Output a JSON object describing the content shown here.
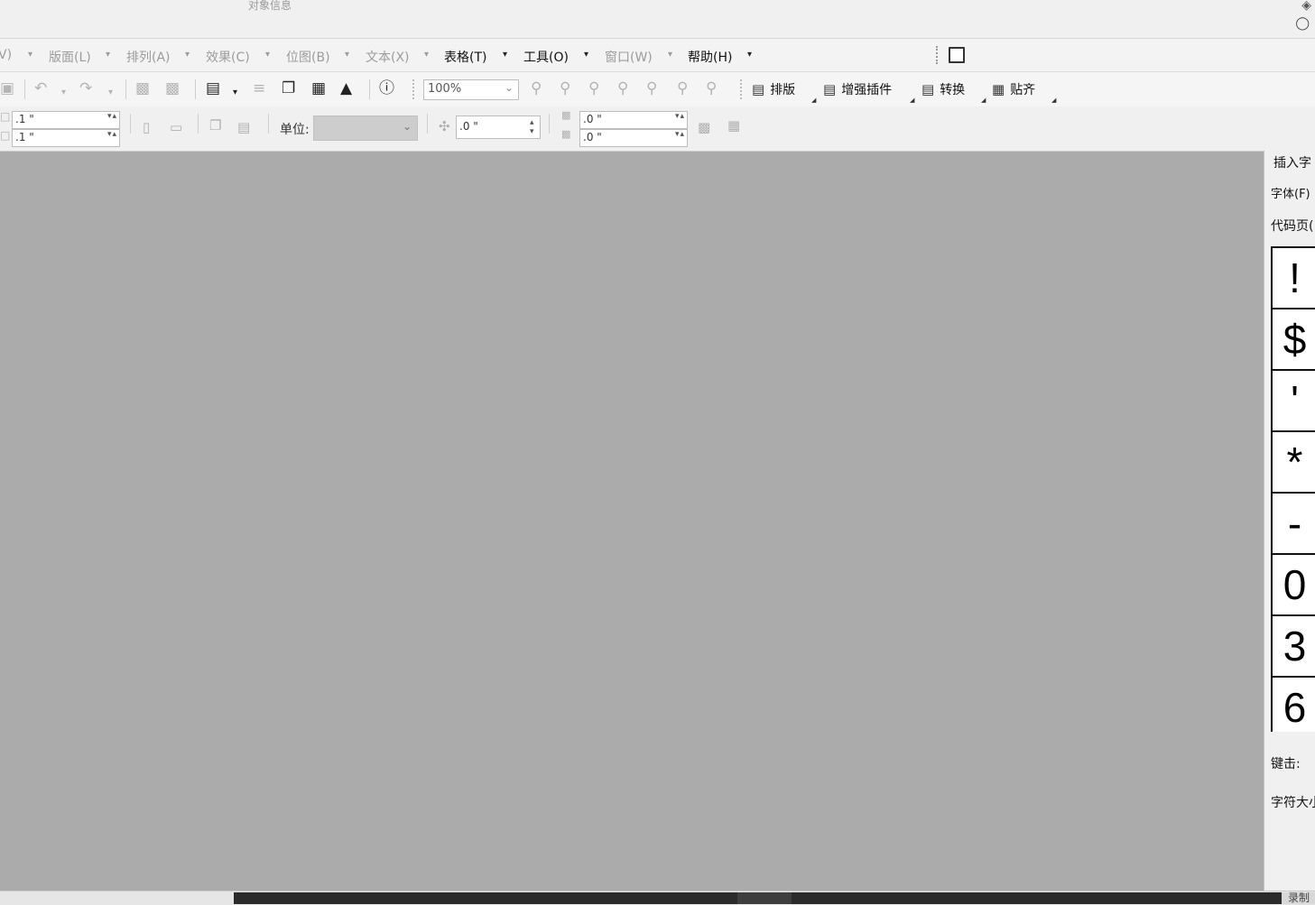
{
  "title_strip": {
    "object_info": "对象信息"
  },
  "menubar": {
    "items": [
      {
        "label": "V)",
        "dim": true
      },
      {
        "label": "版面(L)",
        "dim": true
      },
      {
        "label": "排列(A)",
        "dim": true
      },
      {
        "label": "效果(C)",
        "dim": true
      },
      {
        "label": "位图(B)",
        "dim": true
      },
      {
        "label": "文本(X)",
        "dim": true
      },
      {
        "label": "表格(T)",
        "dim": false
      },
      {
        "label": "工具(O)",
        "dim": false
      },
      {
        "label": "窗口(W)",
        "dim": true
      },
      {
        "label": "帮助(H)",
        "dim": false
      }
    ]
  },
  "toolbar": {
    "zoom": "100%",
    "buttons": {
      "layout": "排版",
      "plugin": "增强插件",
      "convert": "转换",
      "snap": "贴齐"
    }
  },
  "propbar": {
    "width_value": ".1 \"",
    "height_value": ".1 \"",
    "unit_label": "单位:",
    "unit_value": "",
    "nudge_value": ".0 \"",
    "dup_x": ".0 \"",
    "dup_y": ".0 \""
  },
  "docker": {
    "tab_label": "插入字",
    "font_label": "字体(F)",
    "codepage_label": "代码页(",
    "glyphs": [
      "!",
      "$",
      "'",
      "*",
      "-",
      "0",
      "3",
      "6"
    ],
    "keystroke_label": "键击:",
    "char_size_label": "字符大小"
  },
  "status": {
    "record_label": "录制"
  }
}
